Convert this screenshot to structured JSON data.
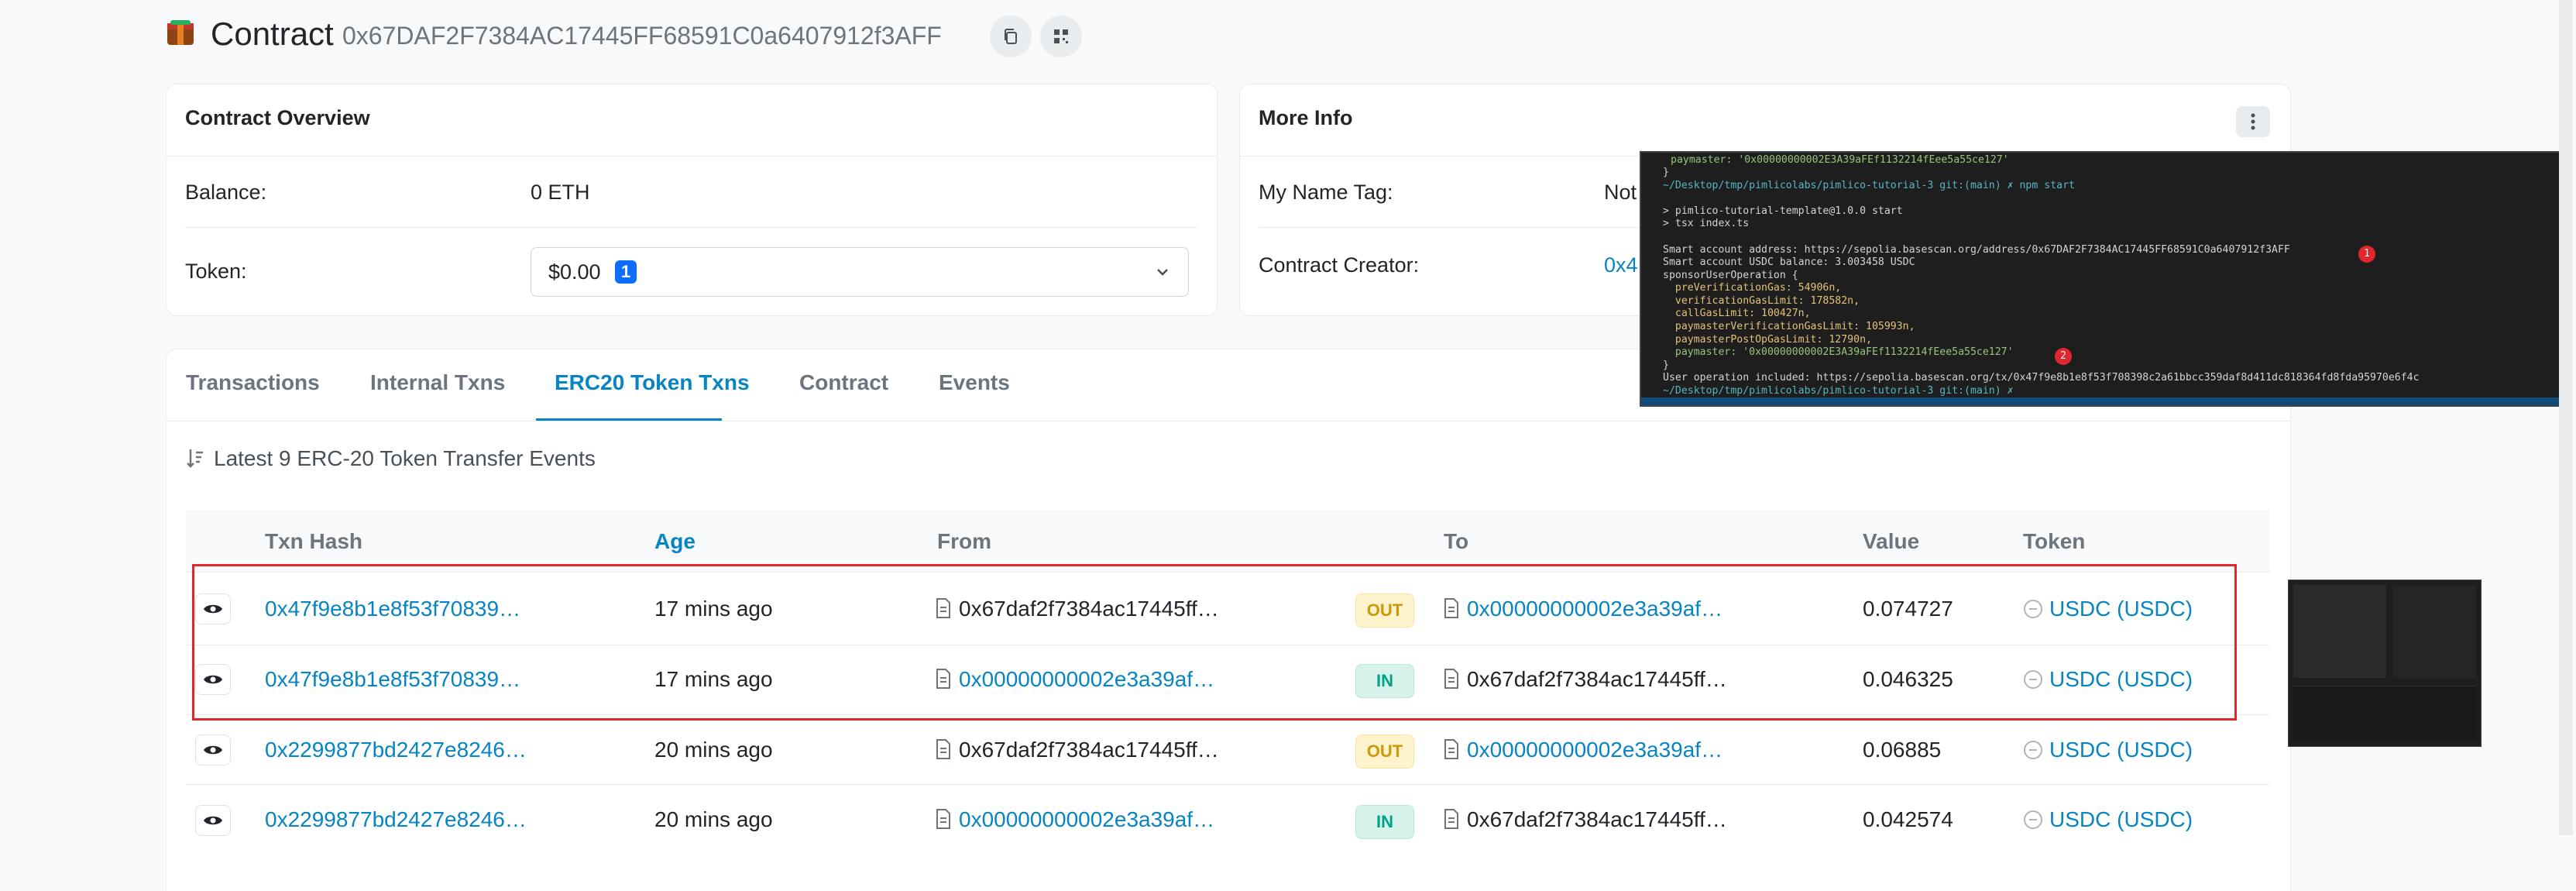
{
  "header": {
    "title": "Contract",
    "address": "0x67DAF2F7384AC17445FF68591C0a6407912f3AFF"
  },
  "overview": {
    "title": "Contract Overview",
    "balance_label": "Balance:",
    "balance_value": "0 ETH",
    "token_label": "Token:",
    "token_value": "$0.00",
    "token_count": "1"
  },
  "more_info": {
    "title": "More Info",
    "name_tag_label": "My Name Tag:",
    "name_tag_value": "Not",
    "creator_label": "Contract Creator:",
    "creator_value": "0x4"
  },
  "tabs": [
    "Transactions",
    "Internal Txns",
    "ERC20 Token Txns",
    "Contract",
    "Events"
  ],
  "active_tab": "ERC20 Token Txns",
  "table": {
    "summary": "Latest 9 ERC-20 Token Transfer Events",
    "headers": [
      "Txn Hash",
      "Age",
      "From",
      "To",
      "Value",
      "Token"
    ],
    "rows": [
      {
        "hash": "0x47f9e8b1e8f53f70839…",
        "age": "17 mins ago",
        "from": "0x67daf2f7384ac17445ff…",
        "dir": "OUT",
        "to": "0x00000000002e3a39af…",
        "value": "0.074727",
        "token": "USDC (USDC)"
      },
      {
        "hash": "0x47f9e8b1e8f53f70839…",
        "age": "17 mins ago",
        "from": "0x00000000002e3a39af…",
        "dir": "IN",
        "to": "0x67daf2f7384ac17445ff…",
        "value": "0.046325",
        "token": "USDC (USDC)"
      },
      {
        "hash": "0x2299877bd2427e8246…",
        "age": "20 mins ago",
        "from": "0x67daf2f7384ac17445ff…",
        "dir": "OUT",
        "to": "0x00000000002e3a39af…",
        "value": "0.06885",
        "token": "USDC (USDC)"
      },
      {
        "hash": "0x2299877bd2427e8246…",
        "age": "20 mins ago",
        "from": "0x00000000002e3a39af…",
        "dir": "IN",
        "to": "0x67daf2f7384ac17445ff…",
        "value": "0.042574",
        "token": "USDC (USDC)"
      }
    ]
  },
  "terminal": {
    "lines": [
      "paymaster: '0x00000000002E3A39aFEf1132214fEee5a55ce127'",
      "}",
      "~/Desktop/tmp/pimlicolabs/pimlico-tutorial-3 git:(main) ✗ npm start",
      "",
      "> pimlico-tutorial-template@1.0.0 start",
      "> tsx index.ts",
      "",
      "Smart account address: https://sepolia.basescan.org/address/0x67DAF2F7384AC17445FF68591C0a6407912f3AFF",
      "Smart account USDC balance: 3.003458 USDC",
      "sponsorUserOperation {",
      "  preVerificationGas: 54906n,",
      "  verificationGasLimit: 178582n,",
      "  callGasLimit: 100427n,",
      "  paymasterVerificationGasLimit: 105993n,",
      "  paymasterPostOpGasLimit: 12790n,",
      "  paymaster: '0x00000000002E3A39aFEf1132214fEee5a55ce127'",
      "}",
      "User operation included: https://sepolia.basescan.org/tx/0x47f9e8b1e8f53f708398c2a61bbcc359daf8d411dc818364fd8fda95970e6f4c",
      "~/Desktop/tmp/pimlicolabs/pimlico-tutorial-3 git:(main) ✗"
    ],
    "marker1": "1",
    "marker2": "2"
  },
  "colors": {
    "link": "#0784c3",
    "highlight_border": "#e1262d",
    "badge_out": "#cc9a06",
    "badge_in": "#00a186"
  }
}
